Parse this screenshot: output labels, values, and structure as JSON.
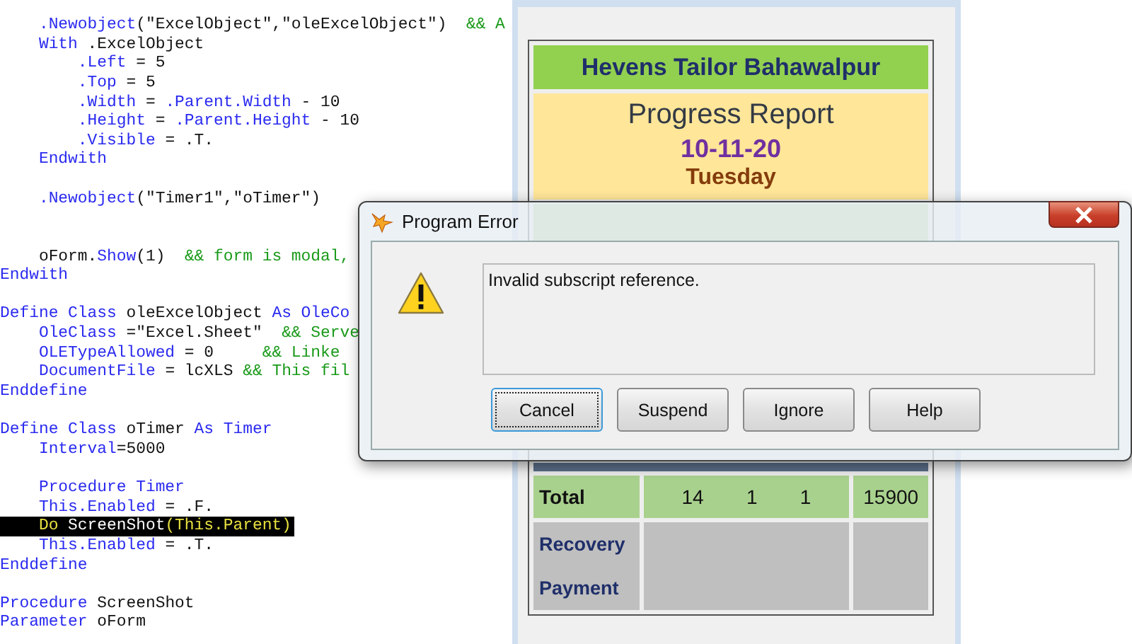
{
  "code_editor": {
    "lines": [
      {
        "kind": "code",
        "highlighted": false,
        "segments": [
          {
            "kind": "keyword",
            "text": "    .Newobject"
          },
          {
            "kind": "plain",
            "text": "(\"ExcelObject\",\"oleExcelObject\")  "
          },
          {
            "kind": "comment",
            "text": "&& A"
          }
        ]
      },
      {
        "kind": "code",
        "highlighted": false,
        "segments": [
          {
            "kind": "keyword",
            "text": "    With"
          },
          {
            "kind": "plain",
            "text": " .ExcelObject"
          }
        ]
      },
      {
        "kind": "code",
        "highlighted": false,
        "segments": [
          {
            "kind": "keyword",
            "text": "        .Left"
          },
          {
            "kind": "plain",
            "text": " = 5"
          }
        ]
      },
      {
        "kind": "code",
        "highlighted": false,
        "segments": [
          {
            "kind": "keyword",
            "text": "        .Top"
          },
          {
            "kind": "plain",
            "text": " = 5"
          }
        ]
      },
      {
        "kind": "code",
        "highlighted": false,
        "segments": [
          {
            "kind": "keyword",
            "text": "        .Width"
          },
          {
            "kind": "plain",
            "text": " = "
          },
          {
            "kind": "keyword",
            "text": ".Parent.Width"
          },
          {
            "kind": "plain",
            "text": " - 10"
          }
        ]
      },
      {
        "kind": "code",
        "highlighted": false,
        "segments": [
          {
            "kind": "keyword",
            "text": "        .Height"
          },
          {
            "kind": "plain",
            "text": " = "
          },
          {
            "kind": "keyword",
            "text": ".Parent.Height"
          },
          {
            "kind": "plain",
            "text": " - 10"
          }
        ]
      },
      {
        "kind": "code",
        "highlighted": false,
        "segments": [
          {
            "kind": "keyword",
            "text": "        .Visible"
          },
          {
            "kind": "plain",
            "text": " = .T."
          }
        ]
      },
      {
        "kind": "code",
        "highlighted": false,
        "segments": [
          {
            "kind": "keyword",
            "text": "    Endwith"
          }
        ]
      },
      {
        "kind": "blank"
      },
      {
        "kind": "code",
        "highlighted": false,
        "segments": [
          {
            "kind": "keyword",
            "text": "    .Newobject"
          },
          {
            "kind": "plain",
            "text": "(\"Timer1\",\"oTimer\")"
          }
        ]
      },
      {
        "kind": "blank"
      },
      {
        "kind": "blank"
      },
      {
        "kind": "code",
        "highlighted": false,
        "segments": [
          {
            "kind": "plain",
            "text": "    oForm."
          },
          {
            "kind": "keyword",
            "text": "Show"
          },
          {
            "kind": "plain",
            "text": "(1)  "
          },
          {
            "kind": "comment",
            "text": "&& form is modal,"
          }
        ]
      },
      {
        "kind": "code",
        "highlighted": false,
        "segments": [
          {
            "kind": "keyword",
            "text": "Endwith"
          }
        ]
      },
      {
        "kind": "blank"
      },
      {
        "kind": "code",
        "highlighted": false,
        "segments": [
          {
            "kind": "keyword",
            "text": "Define Class"
          },
          {
            "kind": "plain",
            "text": " oleExcelObject "
          },
          {
            "kind": "keyword",
            "text": "As OleCo"
          }
        ]
      },
      {
        "kind": "code",
        "highlighted": false,
        "segments": [
          {
            "kind": "keyword",
            "text": "    OleClass"
          },
          {
            "kind": "plain",
            "text": " =\"Excel.Sheet\"  "
          },
          {
            "kind": "comment",
            "text": "&& Serve"
          }
        ]
      },
      {
        "kind": "code",
        "highlighted": false,
        "segments": [
          {
            "kind": "keyword",
            "text": "    OLETypeAllowed"
          },
          {
            "kind": "plain",
            "text": " = 0     "
          },
          {
            "kind": "comment",
            "text": "&& Linke"
          }
        ]
      },
      {
        "kind": "code",
        "highlighted": false,
        "segments": [
          {
            "kind": "keyword",
            "text": "    DocumentFile"
          },
          {
            "kind": "plain",
            "text": " = lcXLS "
          },
          {
            "kind": "comment",
            "text": "&& This fil"
          }
        ]
      },
      {
        "kind": "code",
        "highlighted": false,
        "segments": [
          {
            "kind": "keyword",
            "text": "Enddefine"
          }
        ]
      },
      {
        "kind": "blank"
      },
      {
        "kind": "code",
        "highlighted": false,
        "segments": [
          {
            "kind": "keyword",
            "text": "Define Class"
          },
          {
            "kind": "plain",
            "text": " oTimer "
          },
          {
            "kind": "keyword",
            "text": "As Timer"
          }
        ]
      },
      {
        "kind": "code",
        "highlighted": false,
        "segments": [
          {
            "kind": "keyword",
            "text": "    Interval"
          },
          {
            "kind": "plain",
            "text": "=5000"
          }
        ]
      },
      {
        "kind": "blank"
      },
      {
        "kind": "code",
        "highlighted": false,
        "segments": [
          {
            "kind": "keyword",
            "text": "    Procedure Timer"
          }
        ]
      },
      {
        "kind": "code",
        "highlighted": false,
        "segments": [
          {
            "kind": "keyword",
            "text": "    This.Enabled"
          },
          {
            "kind": "plain",
            "text": " = .F."
          }
        ]
      },
      {
        "kind": "code",
        "highlighted": true,
        "segments": [
          {
            "kind": "keyword",
            "text": "    Do"
          },
          {
            "kind": "plain",
            "text": " ScreenShot"
          },
          {
            "kind": "keyword",
            "text": "(This.Parent)"
          }
        ]
      },
      {
        "kind": "code",
        "highlighted": false,
        "segments": [
          {
            "kind": "keyword",
            "text": "    This.Enabled"
          },
          {
            "kind": "plain",
            "text": " = .T."
          }
        ]
      },
      {
        "kind": "code",
        "highlighted": false,
        "segments": [
          {
            "kind": "keyword",
            "text": "Enddefine"
          }
        ]
      },
      {
        "kind": "blank"
      },
      {
        "kind": "code",
        "highlighted": false,
        "segments": [
          {
            "kind": "keyword",
            "text": "Procedure"
          },
          {
            "kind": "plain",
            "text": " ScreenShot"
          }
        ]
      },
      {
        "kind": "code",
        "highlighted": false,
        "segments": [
          {
            "kind": "keyword",
            "text": "Parameter"
          },
          {
            "kind": "plain",
            "text": " oForm"
          }
        ]
      }
    ]
  },
  "report_window": {
    "company": "Hevens Tailor Bahawalpur",
    "title": "Progress Report",
    "date": "10-11-20",
    "day": "Tuesday",
    "total_row": {
      "label": "Total",
      "counts": [
        "14",
        "1",
        "1"
      ],
      "amount": "15900"
    },
    "footer_rows": [
      "Recovery",
      "Payment"
    ]
  },
  "dialog": {
    "title": "Program Error",
    "message": "Invalid subscript reference.",
    "buttons": [
      {
        "label": "Cancel",
        "focused": true
      },
      {
        "label": "Suspend",
        "focused": false
      },
      {
        "label": "Ignore",
        "focused": false
      },
      {
        "label": "Help",
        "focused": false
      }
    ]
  }
}
